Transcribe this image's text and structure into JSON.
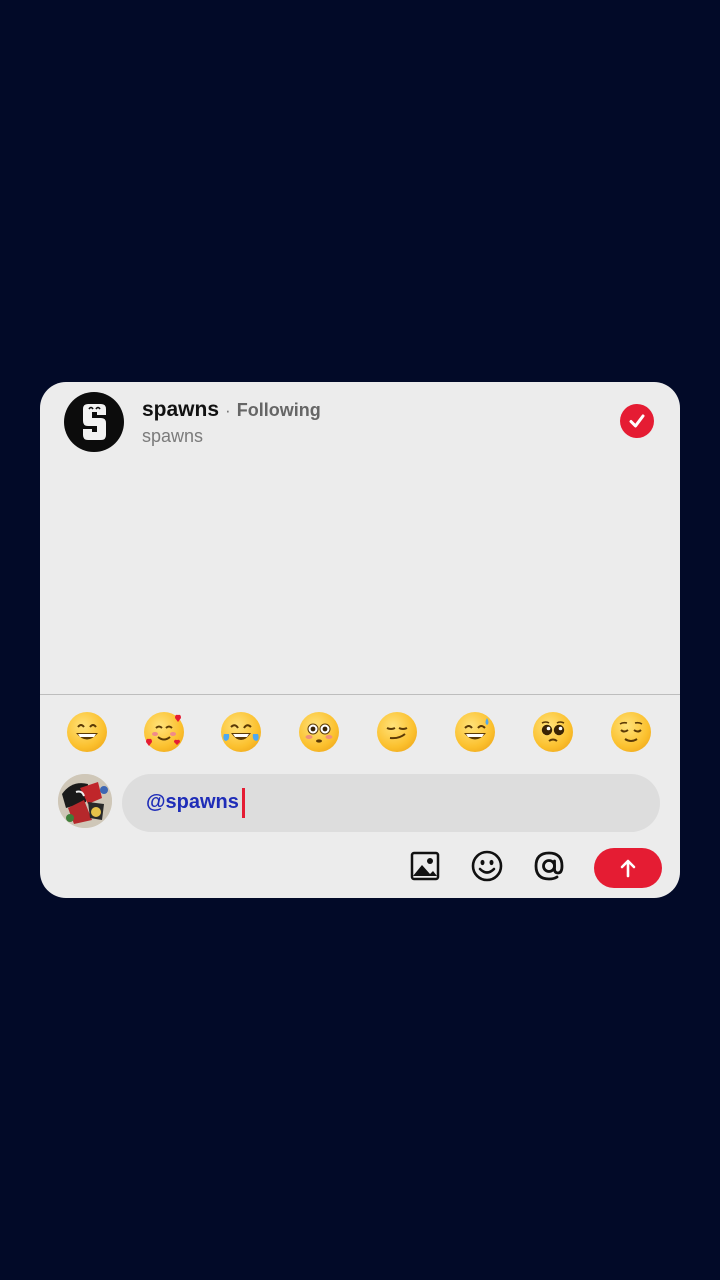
{
  "header": {
    "name": "spawns",
    "separator": "·",
    "follow_status": "Following",
    "handle": "spawns"
  },
  "emoji_row": [
    {
      "icon": "grinning-face-icon"
    },
    {
      "icon": "smiling-face-with-hearts-icon"
    },
    {
      "icon": "face-with-tears-of-joy-icon"
    },
    {
      "icon": "flushed-face-icon"
    },
    {
      "icon": "smirking-face-icon"
    },
    {
      "icon": "grinning-face-with-sweat-icon"
    },
    {
      "icon": "pleading-face-icon"
    },
    {
      "icon": "relieved-face-icon"
    }
  ],
  "composer": {
    "input_value": "@spawns"
  },
  "toolbar": {
    "icons": [
      "image-icon",
      "emoji-icon",
      "mention-icon",
      "send-arrow-icon"
    ]
  },
  "colors": {
    "accent": "#e51c33",
    "mention_text": "#1f2db8",
    "background": "#020a28",
    "card": "#ececec"
  }
}
